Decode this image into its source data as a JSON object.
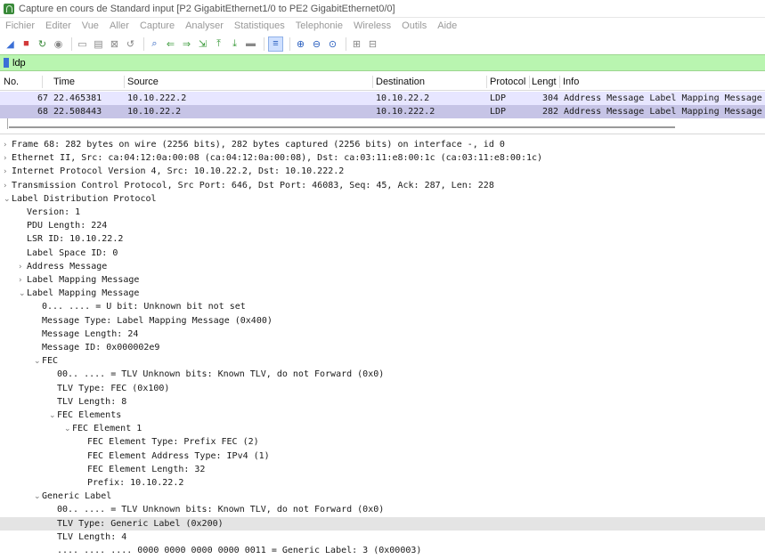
{
  "window": {
    "title": "Capture en cours de Standard input [P2 GigabitEthernet1/0 to PE2 GigabitEthernet0/0]"
  },
  "menu": [
    "Fichier",
    "Editer",
    "Vue",
    "Aller",
    "Capture",
    "Analyser",
    "Statistiques",
    "Telephonie",
    "Wireless",
    "Outils",
    "Aide"
  ],
  "toolbar": [
    "shark-fin-icon",
    "stop-icon",
    "restart-icon",
    "options-icon",
    "open-icon",
    "save-icon",
    "close-file-icon",
    "reload-icon",
    "find-icon",
    "back-icon",
    "forward-icon",
    "go-to-icon",
    "first-icon",
    "last-icon",
    "autoscroll-icon",
    "colorize-icon",
    "zoom-in-icon",
    "zoom-out-icon",
    "zoom-reset-icon",
    "resize-columns-icon",
    "layout-icon"
  ],
  "filter": {
    "value": "ldp"
  },
  "columns": [
    "No.",
    "Time",
    "Source",
    "Destination",
    "Protocol",
    "Lengtl",
    "Info"
  ],
  "packets": [
    {
      "no": "67",
      "time": "22.465381",
      "source": "10.10.222.2",
      "destination": "10.10.22.2",
      "protocol": "LDP",
      "length": "304",
      "info": "Address Message Label Mapping Message"
    },
    {
      "no": "68",
      "time": "22.508443",
      "source": "10.10.22.2",
      "destination": "10.10.222.2",
      "protocol": "LDP",
      "length": "282",
      "info": "Address Message Label Mapping Message"
    }
  ],
  "details": [
    {
      "indent": 0,
      "arrow": "›",
      "text": "Frame 68: 282 bytes on wire (2256 bits), 282 bytes captured (2256 bits) on interface -, id 0"
    },
    {
      "indent": 0,
      "arrow": "›",
      "text": "Ethernet II, Src: ca:04:12:0a:00:08 (ca:04:12:0a:00:08), Dst: ca:03:11:e8:00:1c (ca:03:11:e8:00:1c)"
    },
    {
      "indent": 0,
      "arrow": "›",
      "text": "Internet Protocol Version 4, Src: 10.10.22.2, Dst: 10.10.222.2"
    },
    {
      "indent": 0,
      "arrow": "›",
      "text": "Transmission Control Protocol, Src Port: 646, Dst Port: 46083, Seq: 45, Ack: 287, Len: 228"
    },
    {
      "indent": 0,
      "arrow": "⌄",
      "text": "Label Distribution Protocol"
    },
    {
      "indent": 1,
      "arrow": "",
      "text": "Version: 1"
    },
    {
      "indent": 1,
      "arrow": "",
      "text": "PDU Length: 224"
    },
    {
      "indent": 1,
      "arrow": "",
      "text": "LSR ID: 10.10.22.2"
    },
    {
      "indent": 1,
      "arrow": "",
      "text": "Label Space ID: 0"
    },
    {
      "indent": 1,
      "arrow": "›",
      "text": "Address Message"
    },
    {
      "indent": 1,
      "arrow": "›",
      "text": "Label Mapping Message"
    },
    {
      "indent": 1,
      "arrow": "⌄",
      "text": "Label Mapping Message"
    },
    {
      "indent": 2,
      "arrow": "",
      "text": "0... .... = U bit: Unknown bit not set"
    },
    {
      "indent": 2,
      "arrow": "",
      "text": "Message Type: Label Mapping Message (0x400)"
    },
    {
      "indent": 2,
      "arrow": "",
      "text": "Message Length: 24"
    },
    {
      "indent": 2,
      "arrow": "",
      "text": "Message ID: 0x000002e9"
    },
    {
      "indent": 2,
      "arrow": "⌄",
      "text": "FEC"
    },
    {
      "indent": 3,
      "arrow": "",
      "text": "00.. .... = TLV Unknown bits: Known TLV, do not Forward (0x0)"
    },
    {
      "indent": 3,
      "arrow": "",
      "text": "TLV Type: FEC (0x100)"
    },
    {
      "indent": 3,
      "arrow": "",
      "text": "TLV Length: 8"
    },
    {
      "indent": 3,
      "arrow": "⌄",
      "text": "FEC Elements"
    },
    {
      "indent": 4,
      "arrow": "⌄",
      "text": "FEC Element 1"
    },
    {
      "indent": 5,
      "arrow": "",
      "text": "FEC Element Type: Prefix FEC (2)"
    },
    {
      "indent": 5,
      "arrow": "",
      "text": "FEC Element Address Type: IPv4 (1)"
    },
    {
      "indent": 5,
      "arrow": "",
      "text": "FEC Element Length: 32"
    },
    {
      "indent": 5,
      "arrow": "",
      "text": "Prefix: 10.10.22.2"
    },
    {
      "indent": 2,
      "arrow": "⌄",
      "text": "Generic Label"
    },
    {
      "indent": 3,
      "arrow": "",
      "text": "00.. .... = TLV Unknown bits: Known TLV, do not Forward (0x0)"
    },
    {
      "indent": 3,
      "arrow": "",
      "text": "TLV Type: Generic Label (0x200)",
      "selected": true
    },
    {
      "indent": 3,
      "arrow": "",
      "text": "TLV Length: 4"
    },
    {
      "indent": 3,
      "arrow": "",
      "text": ".... .... .... 0000 0000 0000 0000 0011 = Generic Label: 3 (0x00003)"
    }
  ]
}
